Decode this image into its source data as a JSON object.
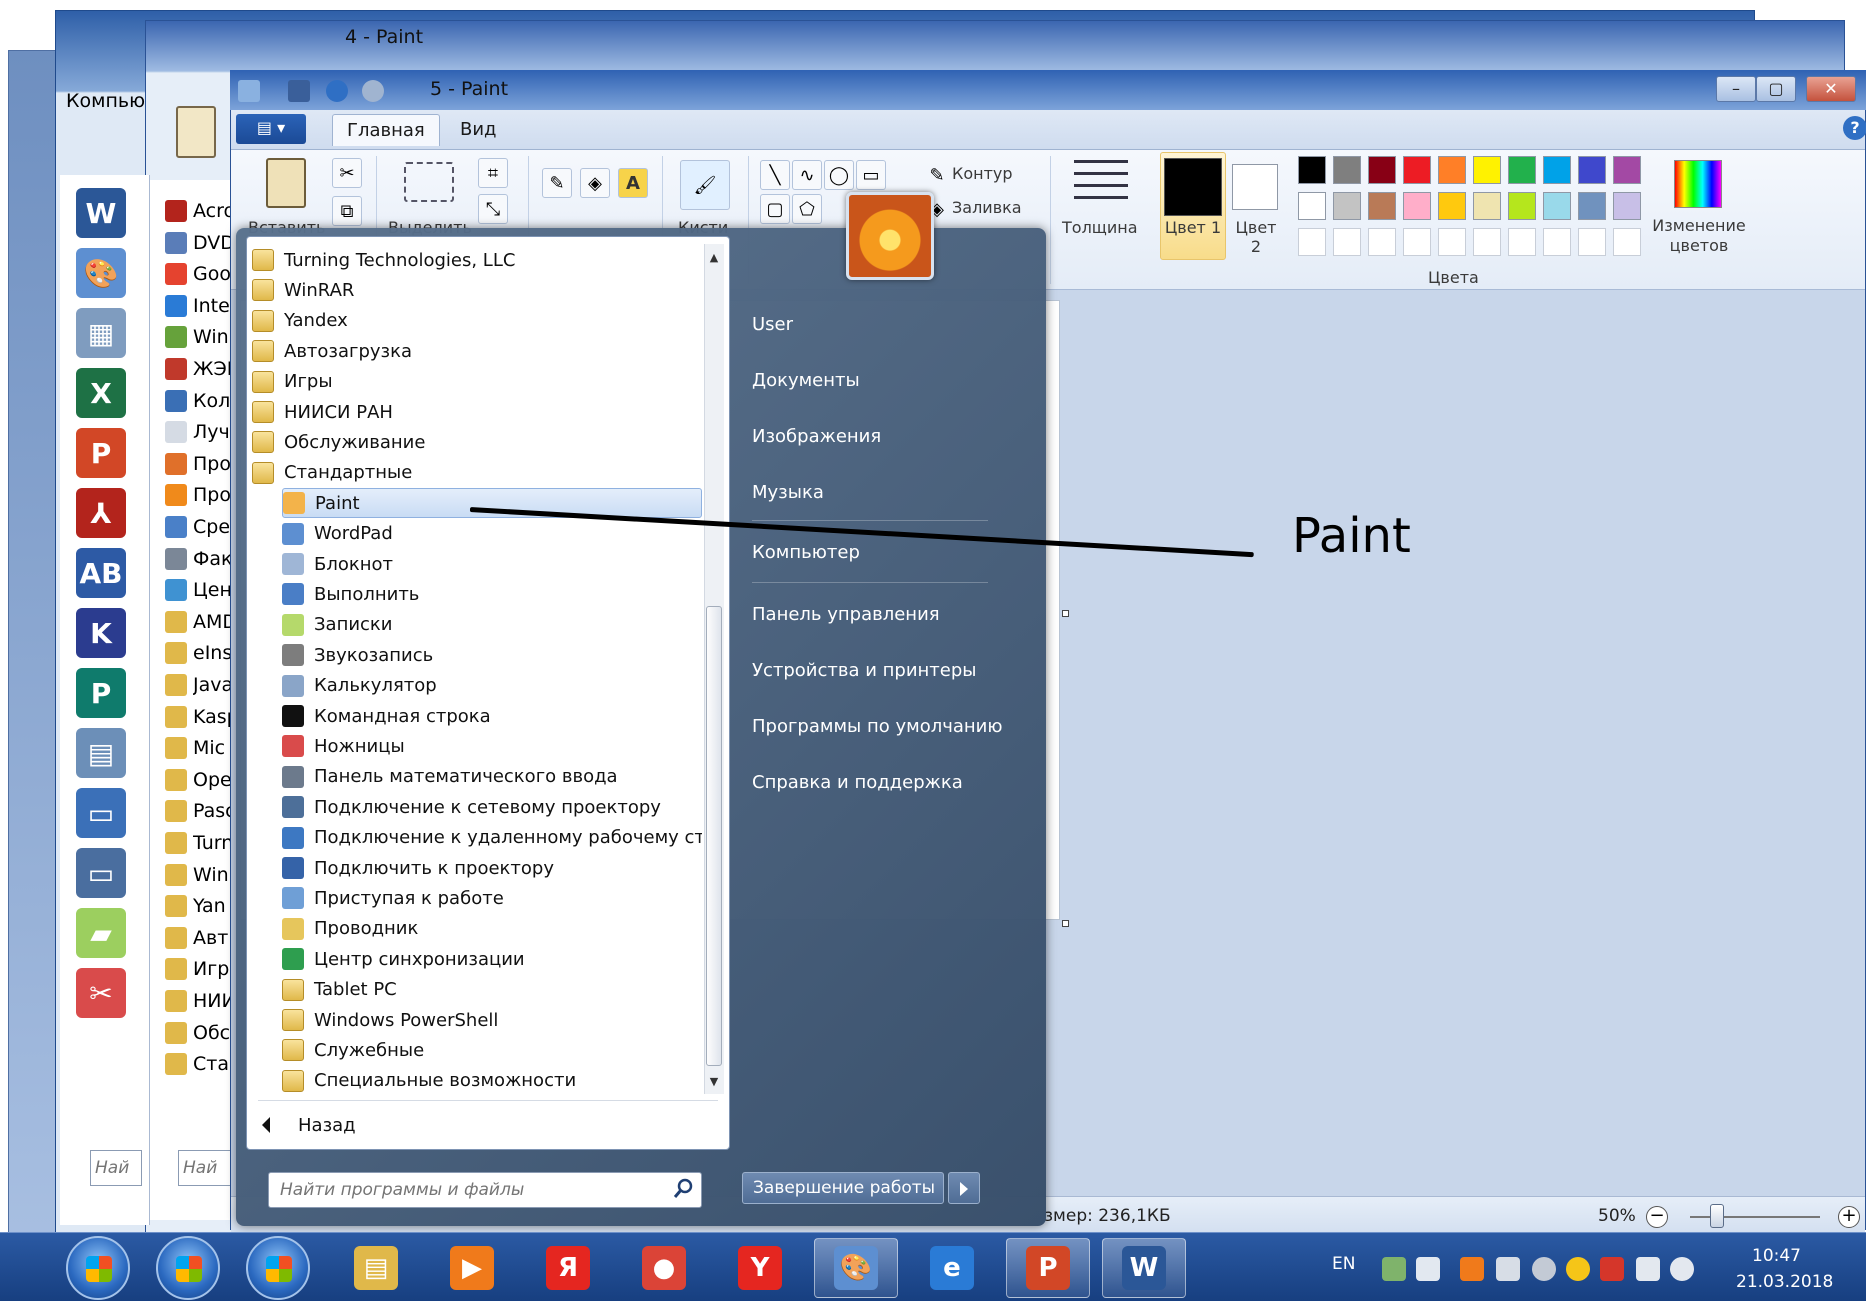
{
  "desktop": {
    "computer_label": "Компью"
  },
  "window4": {
    "title": "4 - Paint",
    "paste_label": "Вставить",
    "start_items": [
      {
        "label": "Acro",
        "color": "#b3241c"
      },
      {
        "label": "DVD",
        "color": "#5a7db8"
      },
      {
        "label": "Goo",
        "color": "#e5432f"
      },
      {
        "label": "Inter",
        "color": "#2a7bd6"
      },
      {
        "label": "Win",
        "color": "#66a23b"
      },
      {
        "label": "ЖЭК",
        "color": "#c0392b"
      },
      {
        "label": "Кол",
        "color": "#3a6fb5"
      },
      {
        "label": "Луч",
        "color": "#d5dbe4"
      },
      {
        "label": "Про",
        "color": "#e0702a"
      },
      {
        "label": "Про",
        "color": "#f08a1b"
      },
      {
        "label": "Сре",
        "color": "#4a80c8"
      },
      {
        "label": "Фак",
        "color": "#7b8797"
      },
      {
        "label": "Цен",
        "color": "#3f92d2"
      },
      {
        "label": "AMD",
        "color": "#e0b84a"
      },
      {
        "label": "eIns",
        "color": "#e0b84a"
      },
      {
        "label": "Java",
        "color": "#e0b84a"
      },
      {
        "label": "Kasp",
        "color": "#e0b84a"
      },
      {
        "label": "Mic",
        "color": "#e0b84a"
      },
      {
        "label": "Ope",
        "color": "#e0b84a"
      },
      {
        "label": "Pasc",
        "color": "#e0b84a"
      },
      {
        "label": "Turn",
        "color": "#e0b84a"
      },
      {
        "label": "Win",
        "color": "#e0b84a"
      },
      {
        "label": "Yan",
        "color": "#e0b84a"
      },
      {
        "label": "Авт",
        "color": "#e0b84a"
      },
      {
        "label": "Игр",
        "color": "#e0b84a"
      },
      {
        "label": "НИИ",
        "color": "#e0b84a"
      },
      {
        "label": "Обс",
        "color": "#e0b84a"
      },
      {
        "label": "Стан",
        "color": "#e0b84a"
      }
    ],
    "search_placeholder": "Най"
  },
  "apps_strip": {
    "icons": [
      {
        "name": "word-icon",
        "glyph": "W",
        "color": "#2b5797"
      },
      {
        "name": "paint-icon",
        "glyph": "🎨",
        "color": "#5d8fd1"
      },
      {
        "name": "calculator-icon",
        "glyph": "▦",
        "color": "#7f9cbf"
      },
      {
        "name": "excel-icon",
        "glyph": "X",
        "color": "#1e7145"
      },
      {
        "name": "powerpoint-icon",
        "glyph": "P",
        "color": "#d24726"
      },
      {
        "name": "acrobat-icon",
        "glyph": "⅄",
        "color": "#b3241c"
      },
      {
        "name": "abbyy-icon",
        "glyph": "AB",
        "color": "#2d5aa5"
      },
      {
        "name": "kaspersky-icon",
        "glyph": "K",
        "color": "#2b3c8f"
      },
      {
        "name": "publisher-icon",
        "glyph": "P",
        "color": "#0f7b6c"
      },
      {
        "name": "document-icon",
        "glyph": "▤",
        "color": "#6c8fb8"
      },
      {
        "name": "monitor-icon",
        "glyph": "▭",
        "color": "#3b70b8"
      },
      {
        "name": "remote-desktop-icon",
        "glyph": "▭",
        "color": "#4a6e9f"
      },
      {
        "name": "sticky-notes-icon",
        "glyph": "▰",
        "color": "#9ccf5f"
      },
      {
        "name": "scissors-icon",
        "glyph": "✂",
        "color": "#d94b4b"
      }
    ],
    "search_placeholder": "Най"
  },
  "paint": {
    "title": "5 - Paint",
    "file_tab_label": "▤ ▾",
    "tabs": [
      {
        "label": "Главная",
        "active": true
      },
      {
        "label": "Вид",
        "active": false
      }
    ],
    "ribbon": {
      "paste": "Вставить",
      "select": "Выделить",
      "brushes": "Кисти",
      "outline": "Контур",
      "fill": "Заливка",
      "thickness": "Толщина",
      "color1": "Цвет 1",
      "color2": "Цвет 2",
      "edit_colors": "Изменение цветов",
      "colors_group": "Цвета"
    },
    "palette_row1": [
      "#000000",
      "#7f7f7f",
      "#880015",
      "#ed1c24",
      "#ff7f27",
      "#fff200",
      "#22b14c",
      "#00a2e8",
      "#3f48cc",
      "#a349a4"
    ],
    "palette_row2": [
      "#ffffff",
      "#c3c3c3",
      "#b97a57",
      "#ffaec9",
      "#ffc90e",
      "#efe4b0",
      "#b5e61d",
      "#99d9ea",
      "#7092be",
      "#c8bfe7"
    ],
    "status": {
      "size": "змер: 236,1КБ",
      "zoom": "50%"
    }
  },
  "startmenu": {
    "programs": [
      {
        "label": "Turning Technologies, LLC",
        "type": "folder",
        "indent": false,
        "color": ""
      },
      {
        "label": "WinRAR",
        "type": "folder",
        "indent": false,
        "color": ""
      },
      {
        "label": "Yandex",
        "type": "folder",
        "indent": false,
        "color": ""
      },
      {
        "label": "Автозагрузка",
        "type": "folder",
        "indent": false,
        "color": ""
      },
      {
        "label": "Игры",
        "type": "folder",
        "indent": false,
        "color": ""
      },
      {
        "label": "НИИСИ РАН",
        "type": "folder",
        "indent": false,
        "color": ""
      },
      {
        "label": "Обслуживание",
        "type": "folder",
        "indent": false,
        "color": ""
      },
      {
        "label": "Стандартные",
        "type": "folder",
        "indent": false,
        "color": ""
      },
      {
        "label": "Paint",
        "type": "app",
        "indent": true,
        "color": "#f3b34a",
        "highlight": true
      },
      {
        "label": "WordPad",
        "type": "app",
        "indent": true,
        "color": "#5d8fd1"
      },
      {
        "label": "Блокнот",
        "type": "app",
        "indent": true,
        "color": "#9fb6d6"
      },
      {
        "label": "Выполнить",
        "type": "app",
        "indent": true,
        "color": "#4a7ec6"
      },
      {
        "label": "Записки",
        "type": "app",
        "indent": true,
        "color": "#b5d96b"
      },
      {
        "label": "Звукозапись",
        "type": "app",
        "indent": true,
        "color": "#7d7d7d"
      },
      {
        "label": "Калькулятор",
        "type": "app",
        "indent": true,
        "color": "#8aa5c8"
      },
      {
        "label": "Командная строка",
        "type": "app",
        "indent": true,
        "color": "#111111"
      },
      {
        "label": "Ножницы",
        "type": "app",
        "indent": true,
        "color": "#d94b4b"
      },
      {
        "label": "Панель математического ввода",
        "type": "app",
        "indent": true,
        "color": "#6c7a8c"
      },
      {
        "label": "Подключение к сетевому проектору",
        "type": "app",
        "indent": true,
        "color": "#4d6f99"
      },
      {
        "label": "Подключение к удаленному рабочему стол",
        "type": "app",
        "indent": true,
        "color": "#3d78c2"
      },
      {
        "label": "Подключить к проектору",
        "type": "app",
        "indent": true,
        "color": "#3563a8"
      },
      {
        "label": "Приступая к работе",
        "type": "app",
        "indent": true,
        "color": "#6f9fd6"
      },
      {
        "label": "Проводник",
        "type": "app",
        "indent": true,
        "color": "#e6c65c"
      },
      {
        "label": "Центр синхронизации",
        "type": "app",
        "indent": true,
        "color": "#2e9e4f"
      },
      {
        "label": "Tablet PC",
        "type": "folder",
        "indent": true,
        "color": ""
      },
      {
        "label": "Windows PowerShell",
        "type": "folder",
        "indent": true,
        "color": ""
      },
      {
        "label": "Служебные",
        "type": "folder",
        "indent": true,
        "color": ""
      },
      {
        "label": "Специальные возможности",
        "type": "folder",
        "indent": true,
        "color": ""
      }
    ],
    "back_label": "Назад",
    "search_placeholder": "Найти программы и файлы",
    "right_links": [
      "User",
      "Документы",
      "Изображения",
      "Музыка",
      "Компьютер",
      "Панель управления",
      "Устройства и принтеры",
      "Программы по умолчанию",
      "Справка и поддержка"
    ],
    "shutdown_label": "Завершение работы"
  },
  "annotation": {
    "label": "Paint"
  },
  "taskbar": {
    "buttons": [
      {
        "name": "explorer-icon",
        "glyph": "▤",
        "color": "#e0b84a",
        "active": false
      },
      {
        "name": "media-player-icon",
        "glyph": "▶",
        "color": "#f07a1b",
        "active": false
      },
      {
        "name": "yandex-icon",
        "glyph": "Я",
        "color": "#e52620",
        "active": false
      },
      {
        "name": "chrome-icon",
        "glyph": "●",
        "color": "#db4437",
        "active": false
      },
      {
        "name": "yandex-browser-icon",
        "glyph": "Y",
        "color": "#e52620",
        "active": false
      },
      {
        "name": "paint-taskbar-icon",
        "glyph": "🎨",
        "color": "#5d8fd1",
        "active": true
      },
      {
        "name": "ie-icon",
        "glyph": "e",
        "color": "#2a7bd6",
        "active": false
      },
      {
        "name": "powerpoint-taskbar-icon",
        "glyph": "P",
        "color": "#d24726",
        "active": true
      },
      {
        "name": "word-taskbar-icon",
        "glyph": "W",
        "color": "#2b5797",
        "active": true
      }
    ],
    "lang": "EN",
    "time": "10:47",
    "date": "21.03.2018"
  }
}
